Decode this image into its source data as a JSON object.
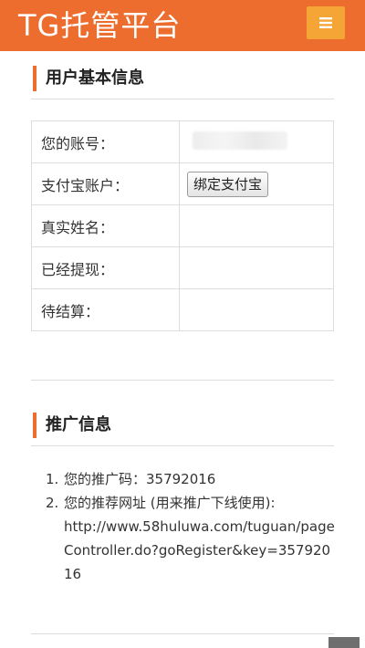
{
  "header": {
    "logo_text": "TG托管平台",
    "menu_icon": "hamburger-icon",
    "bg_color": "#ec6d2d",
    "menu_color": "#f4a536"
  },
  "account_section": {
    "title": "用户基本信息",
    "rows": [
      {
        "label": "您的账号：",
        "value": ""
      },
      {
        "label": "支付宝账户：",
        "button": "绑定支付宝"
      },
      {
        "label": "真实姓名：",
        "value": ""
      },
      {
        "label": "已经提现：",
        "value": ""
      },
      {
        "label": "待结算：",
        "value": ""
      }
    ]
  },
  "promo_section": {
    "title": "推广信息",
    "items": [
      {
        "num": "1.",
        "text": "您的推广码：35792016"
      },
      {
        "num": "2.",
        "text": "您的推荐网址 (用来推广下线使用):",
        "url": "http://www.58huluwa.com/tuguan/pageController.do?goRegister&key=35792016"
      }
    ]
  }
}
